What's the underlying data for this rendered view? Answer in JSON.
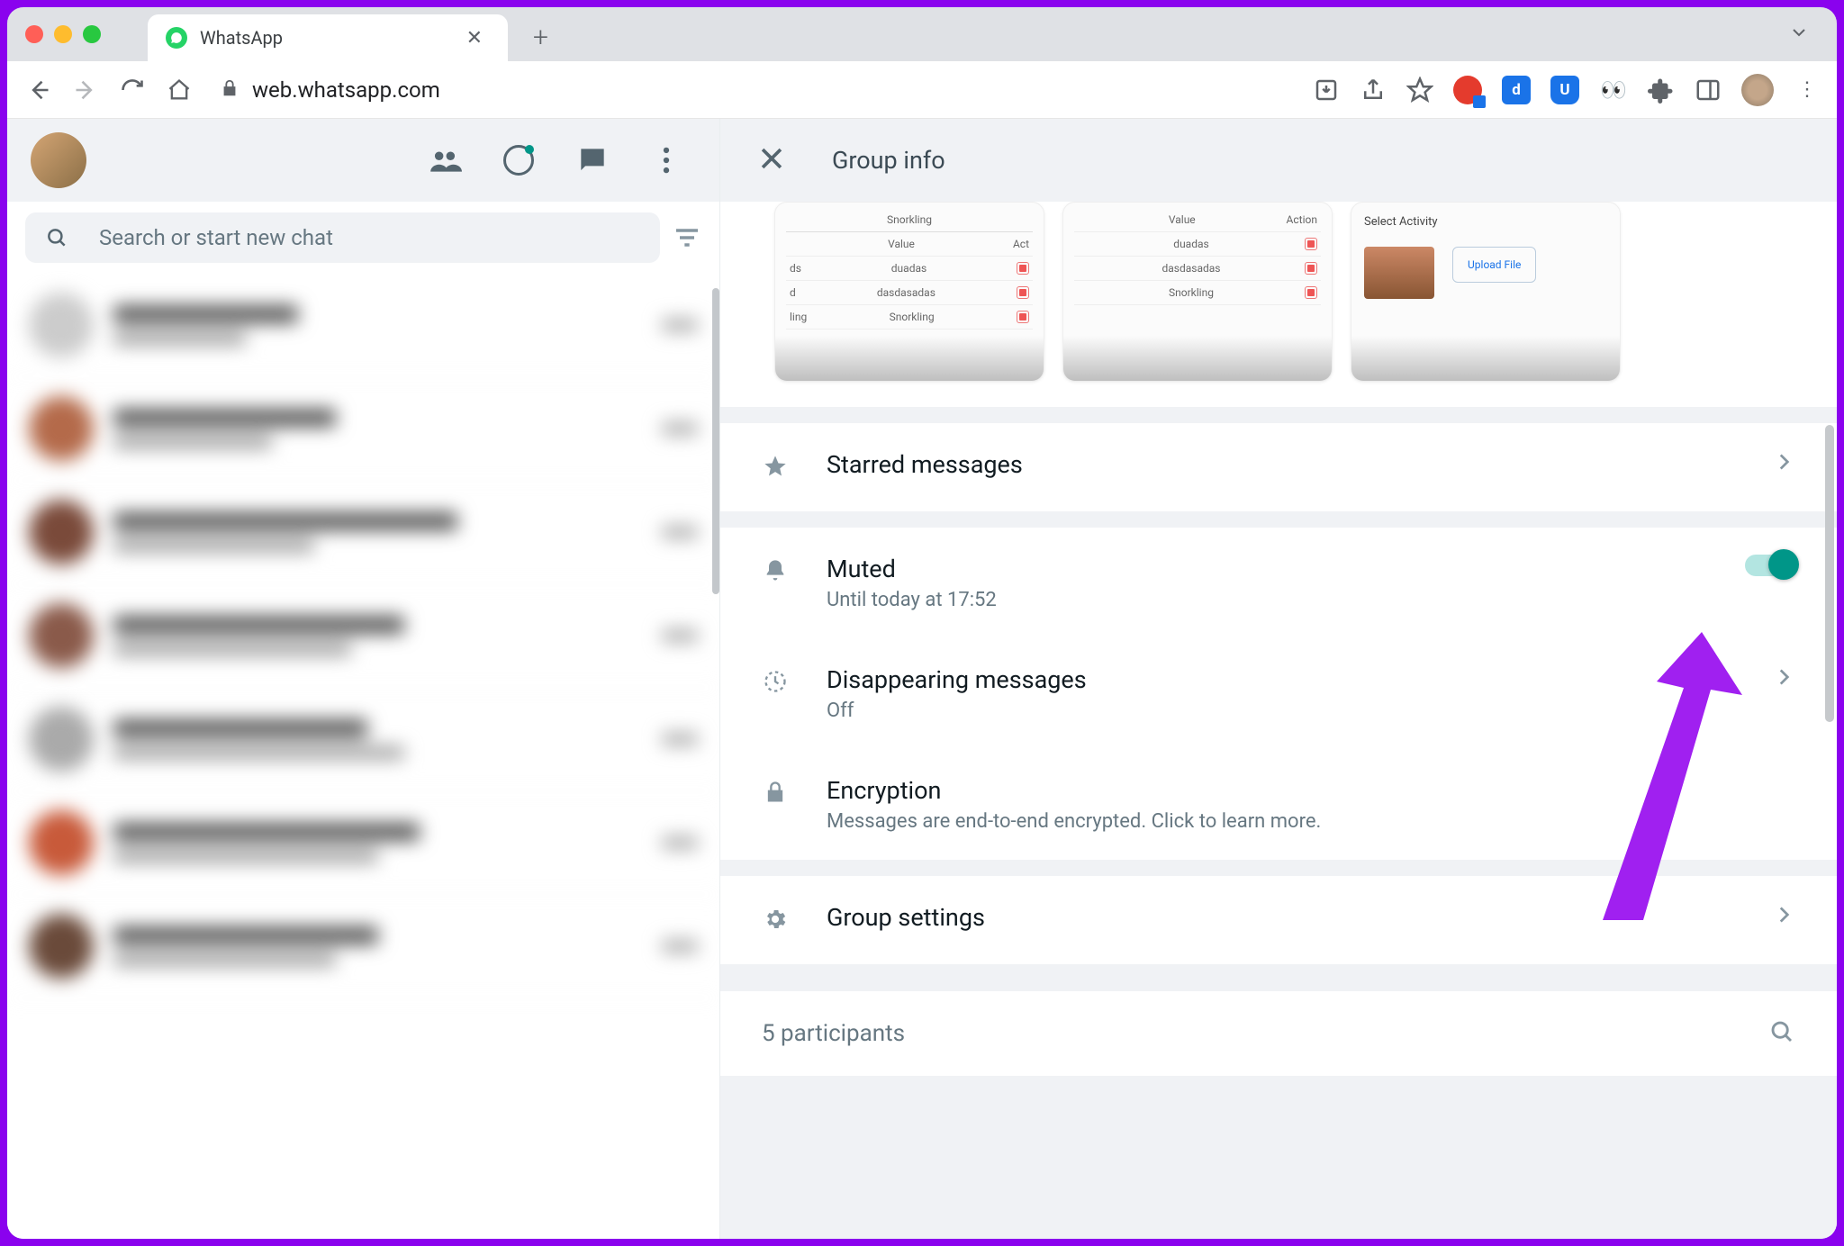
{
  "browser": {
    "tab_title": "WhatsApp",
    "url": "web.whatsapp.com"
  },
  "search": {
    "placeholder": "Search or start new chat"
  },
  "panel": {
    "title": "Group info"
  },
  "media": {
    "card1": {
      "col_value": "Value",
      "col_act": "Act",
      "r1": "duadas",
      "r2": "dasdasadas",
      "r3": "Snorkling",
      "head": "Snorkling"
    },
    "card2": {
      "col_value": "Value",
      "col_act": "Action",
      "r1": "duadas",
      "r2": "dasdasadas",
      "r3": "Snorkling"
    },
    "card3": {
      "title": "Select Activity",
      "upload": "Upload File"
    }
  },
  "rows": {
    "starred": {
      "title": "Starred messages"
    },
    "muted": {
      "title": "Muted",
      "sub": "Until today at 17:52"
    },
    "disappearing": {
      "title": "Disappearing messages",
      "sub": "Off"
    },
    "encryption": {
      "title": "Encryption",
      "sub": "Messages are end-to-end encrypted. Click to learn more."
    },
    "settings": {
      "title": "Group settings"
    }
  },
  "participants": {
    "text": "5 participants"
  }
}
